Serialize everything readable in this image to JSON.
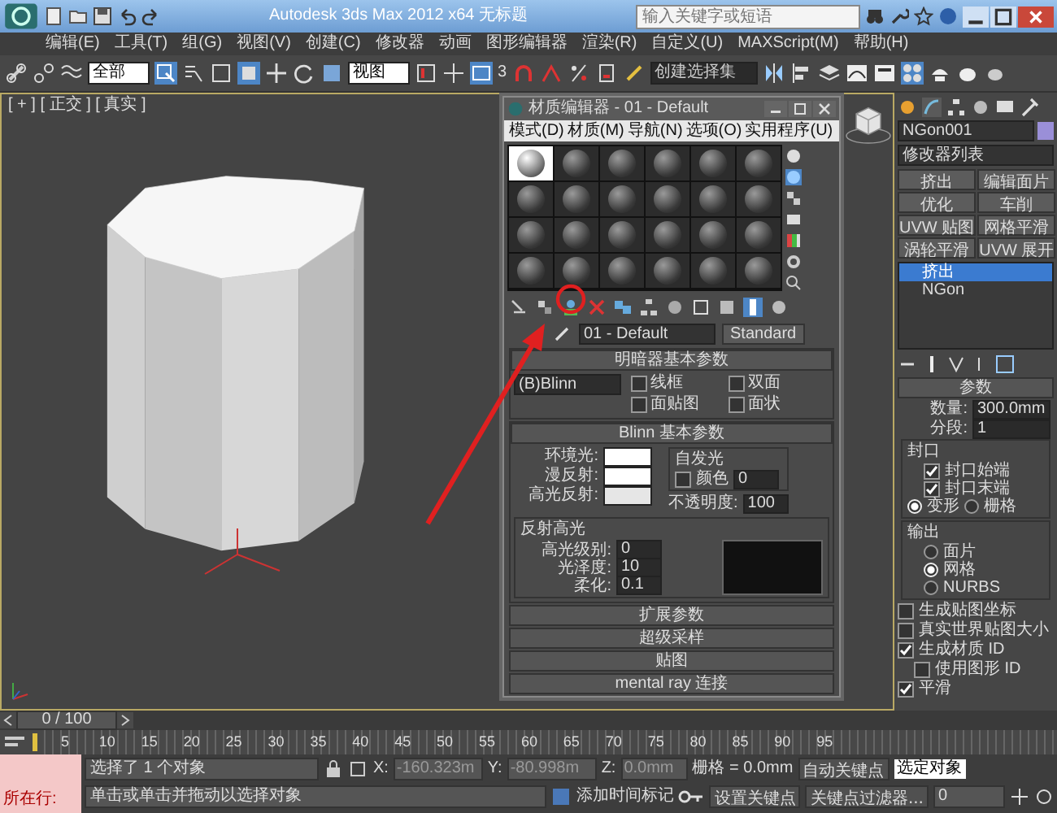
{
  "title_bar": {
    "title": "Autodesk 3ds Max  2012 x64    无标题",
    "search": {
      "placeholder": "输入关键字或短语"
    }
  },
  "menu": [
    "编辑(E)",
    "工具(T)",
    "组(G)",
    "视图(V)",
    "创建(C)",
    "修改器",
    "动画",
    "图形编辑器",
    "渲染(R)",
    "自定义(U)",
    "MAXScript(M)",
    "帮助(H)"
  ],
  "toolbar": {
    "selection_filter": "全部",
    "reference_coord": "视图",
    "snap_label": "3",
    "named_selection": "创建选择集"
  },
  "viewport": {
    "label": "[ + ] [ 正交 ] [ 真实 ]"
  },
  "material_editor": {
    "title": "材质编辑器 - 01 - Default",
    "menu": [
      "模式(D)",
      "材质(M)",
      "导航(N)",
      "选项(O)",
      "实用程序(U)"
    ],
    "slots": [
      {
        "selected": true
      },
      {
        "selected": false
      },
      {
        "selected": false
      },
      {
        "selected": false
      },
      {
        "selected": false
      },
      {
        "selected": false
      },
      {
        "selected": false
      },
      {
        "selected": false
      },
      {
        "selected": false
      },
      {
        "selected": false
      },
      {
        "selected": false
      },
      {
        "selected": false
      },
      {
        "selected": false
      },
      {
        "selected": false
      },
      {
        "selected": false
      },
      {
        "selected": false
      },
      {
        "selected": false
      },
      {
        "selected": false
      },
      {
        "selected": false
      },
      {
        "selected": false
      },
      {
        "selected": false
      },
      {
        "selected": false
      },
      {
        "selected": false
      },
      {
        "selected": false
      }
    ],
    "material_name": "01 - Default",
    "material_type": "Standard",
    "shader_rollout": {
      "title": "明暗器基本参数",
      "shader": "(B)Blinn",
      "options": [
        {
          "label": "线框",
          "checked": false
        },
        {
          "label": "双面",
          "checked": false
        },
        {
          "label": "面贴图",
          "checked": false
        },
        {
          "label": "面状",
          "checked": false
        }
      ]
    },
    "blinn_rollout": {
      "title": "Blinn 基本参数",
      "colors": [
        {
          "label": "环境光:",
          "color": "#ffffff"
        },
        {
          "label": "漫反射:",
          "color": "#ffffff"
        },
        {
          "label": "高光反射:",
          "color": "#e6e6e6"
        }
      ],
      "self_illum": {
        "title": "自发光",
        "label": "颜色",
        "checked": false,
        "value": "0"
      },
      "opacity": {
        "label": "不透明度:",
        "value": "100"
      },
      "highlights": {
        "title": "反射高光",
        "rows": [
          {
            "label": "高光级别:",
            "value": "0"
          },
          {
            "label": "光泽度:",
            "value": "10"
          },
          {
            "label": "柔化:",
            "value": "0.1"
          }
        ]
      }
    },
    "collapsed_rollouts": [
      "扩展参数",
      "超级采样",
      "贴图",
      "mental ray 连接"
    ]
  },
  "command_panel": {
    "object": {
      "name": "NGon001",
      "color": "#9a8fd8"
    },
    "modifier_list": "修改器列表",
    "modifier_buttons": [
      "挤出",
      "编辑面片",
      "优化",
      "车削",
      "UVW 贴图",
      "网格平滑",
      "涡轮平滑",
      "UVW 展开"
    ],
    "stack": [
      {
        "label": "挤出",
        "selected": true
      },
      {
        "label": "NGon",
        "selected": false
      }
    ],
    "params": {
      "title": "参数",
      "amount": {
        "label": "数量:",
        "value": "300.0mm"
      },
      "segments": {
        "label": "分段:",
        "value": "1"
      },
      "capping": {
        "title": "封口",
        "checks": [
          {
            "label": "封口始端",
            "checked": true
          },
          {
            "label": "封口末端",
            "checked": true
          }
        ],
        "radios": [
          {
            "label": "变形",
            "selected": true
          },
          {
            "label": "栅格",
            "selected": false
          }
        ]
      },
      "output": {
        "title": "输出",
        "radios": [
          {
            "label": "面片",
            "selected": false
          },
          {
            "label": "网格",
            "selected": true
          },
          {
            "label": "NURBS",
            "selected": false
          }
        ]
      },
      "checks": [
        {
          "label": "生成贴图坐标",
          "checked": false,
          "indent": false
        },
        {
          "label": "真实世界贴图大小",
          "checked": false,
          "indent": false
        },
        {
          "label": "生成材质 ID",
          "checked": true,
          "indent": false
        },
        {
          "label": "使用图形 ID",
          "checked": false,
          "indent": true
        },
        {
          "label": "平滑",
          "checked": true,
          "indent": false
        }
      ]
    }
  },
  "timeline": {
    "position": "0 / 100",
    "ticks": [
      "5",
      "10",
      "15",
      "20",
      "25",
      "30",
      "35",
      "40",
      "45",
      "50",
      "55",
      "60",
      "65",
      "70",
      "75",
      "80",
      "85",
      "90",
      "95"
    ]
  },
  "status_bar": {
    "script_label": "所在行:",
    "selection": "选择了 1 个对象",
    "prompt": "单击或单击并拖动以选择对象",
    "x": {
      "label": "X:",
      "value": "-160.323m"
    },
    "y": {
      "label": "Y:",
      "value": "-80.998m"
    },
    "z": {
      "label": "Z:",
      "value": "0.0mm"
    },
    "grid": "栅格 = 0.0mm",
    "add_time_tag": "添加时间标记",
    "auto_key": "自动关键点",
    "key_target": "选定对象",
    "set_key": "设置关键点",
    "key_filters": "关键点过滤器...",
    "frame": "0"
  }
}
